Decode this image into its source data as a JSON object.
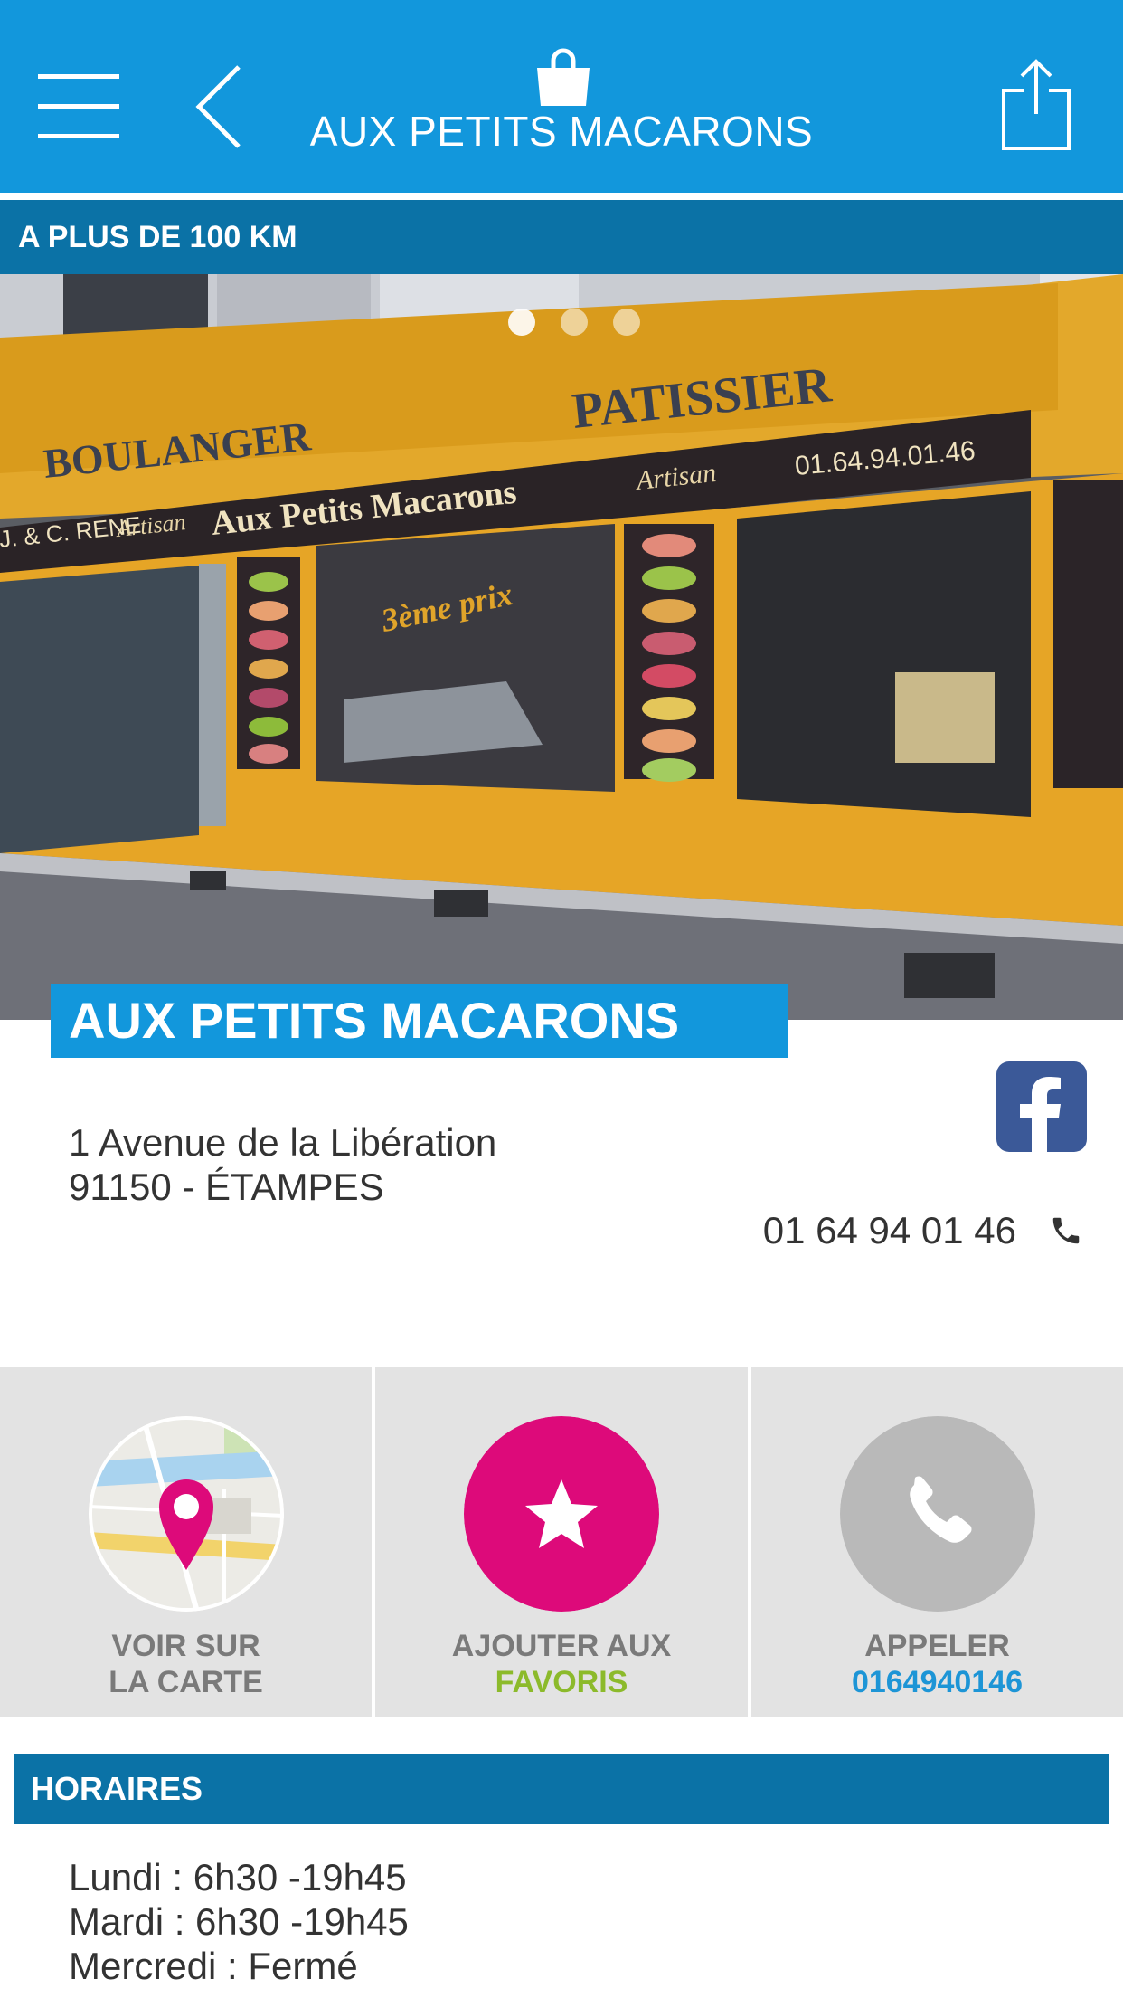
{
  "header": {
    "title": "AUX PETITS MACARONS",
    "menu_icon": "hamburger-menu-icon",
    "back_icon": "chevron-left-icon",
    "logo_icon": "shopping-bag-icon",
    "share_icon": "share-icon"
  },
  "distance": "A PLUS DE 100 KM",
  "photo": {
    "slide_count": 3,
    "active_slide": 1,
    "sign_upper_left": "BOULANGER",
    "sign_upper_right": "PATISSIER",
    "awning_left": "J. & C. RENE",
    "awning_artisan": "Artisan",
    "awning_name": "Aux Petits Macarons",
    "awning_phone": "01.64.94.01.46",
    "window_text": "3ème prix"
  },
  "shop": {
    "name": "AUX PETITS MACARONS",
    "address_line1": "1 Avenue de la Libération",
    "address_line2": "91150 - ÉTAMPES",
    "phone": "01 64 94 01 46"
  },
  "actions": {
    "map": {
      "line1": "VOIR SUR",
      "line2": "LA CARTE"
    },
    "favorites": {
      "line1": "AJOUTER AUX",
      "line2": "FAVORIS"
    },
    "call": {
      "line1": "APPELER",
      "line2": "0164940146"
    }
  },
  "hours": {
    "title": "HORAIRES",
    "items": [
      "Lundi : 6h30 -19h45",
      "Mardi : 6h30 -19h45",
      "Mercredi : Fermé"
    ]
  },
  "colors": {
    "primary": "#1297dc",
    "dark_primary": "#0b72a6",
    "magenta": "#dd0a7a",
    "green": "#8cba2b",
    "facebook": "#3b5998"
  }
}
